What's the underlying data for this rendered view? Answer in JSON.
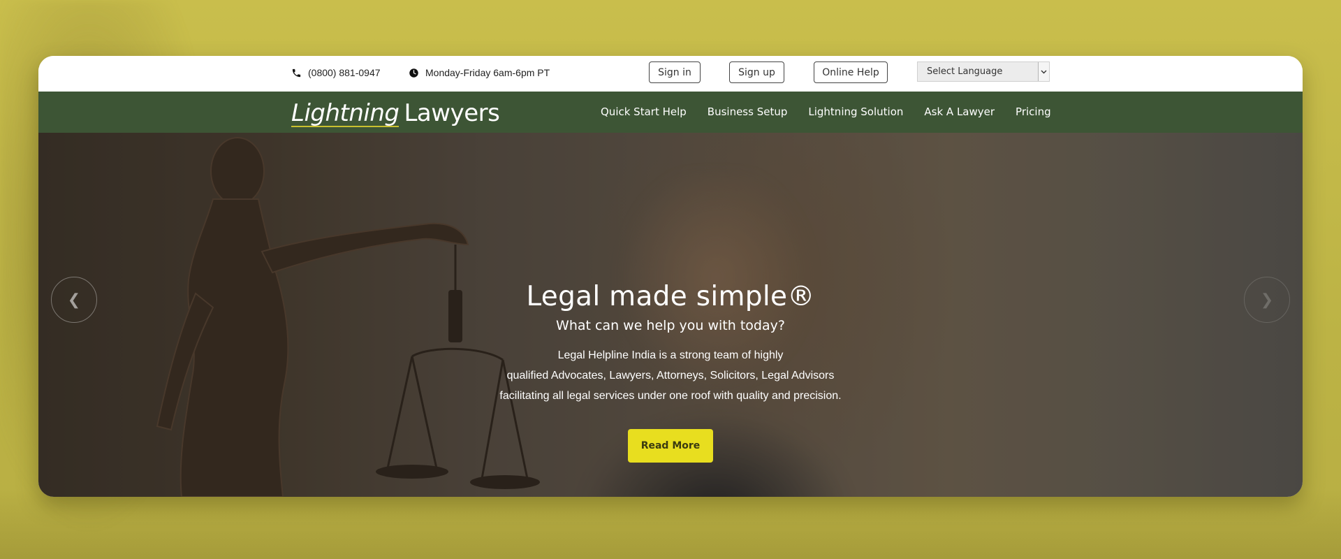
{
  "topbar": {
    "phone": "(0800) 881-0947",
    "phone_icon": "phone-icon",
    "hours": "Monday-Friday 6am-6pm PT",
    "hours_icon": "clock-icon",
    "sign_in": "Sign in",
    "sign_up": "Sign up",
    "online_help": "Online Help",
    "language": {
      "selected": "Select Language",
      "arrow_icon": "chevron-down-icon"
    }
  },
  "navbar": {
    "logo_italic": "Lightning",
    "logo_word": "Lawyers",
    "items": [
      {
        "label": "Quick Start Help"
      },
      {
        "label": "Business Setup"
      },
      {
        "label": "Lightning Solution"
      },
      {
        "label": "Ask A Lawyer"
      },
      {
        "label": "Pricing"
      }
    ]
  },
  "hero": {
    "title": "Legal made simple®",
    "subtitle": "What can we help you with today?",
    "body_lines": [
      "Legal Helpline India is a strong team of highly",
      "qualified Advocates, Lawyers, Attorneys, Solicitors, Legal Advisors",
      "facilitating all legal services under one roof with quality and precision."
    ],
    "cta": "Read More",
    "prev_icon": "chevron-left-icon",
    "next_icon": "chevron-right-icon"
  },
  "colors": {
    "page_background": "#c2b84a",
    "nav_background": "#3d5535",
    "cta_background": "#e8de1f",
    "logo_underline": "#c9c02f"
  }
}
